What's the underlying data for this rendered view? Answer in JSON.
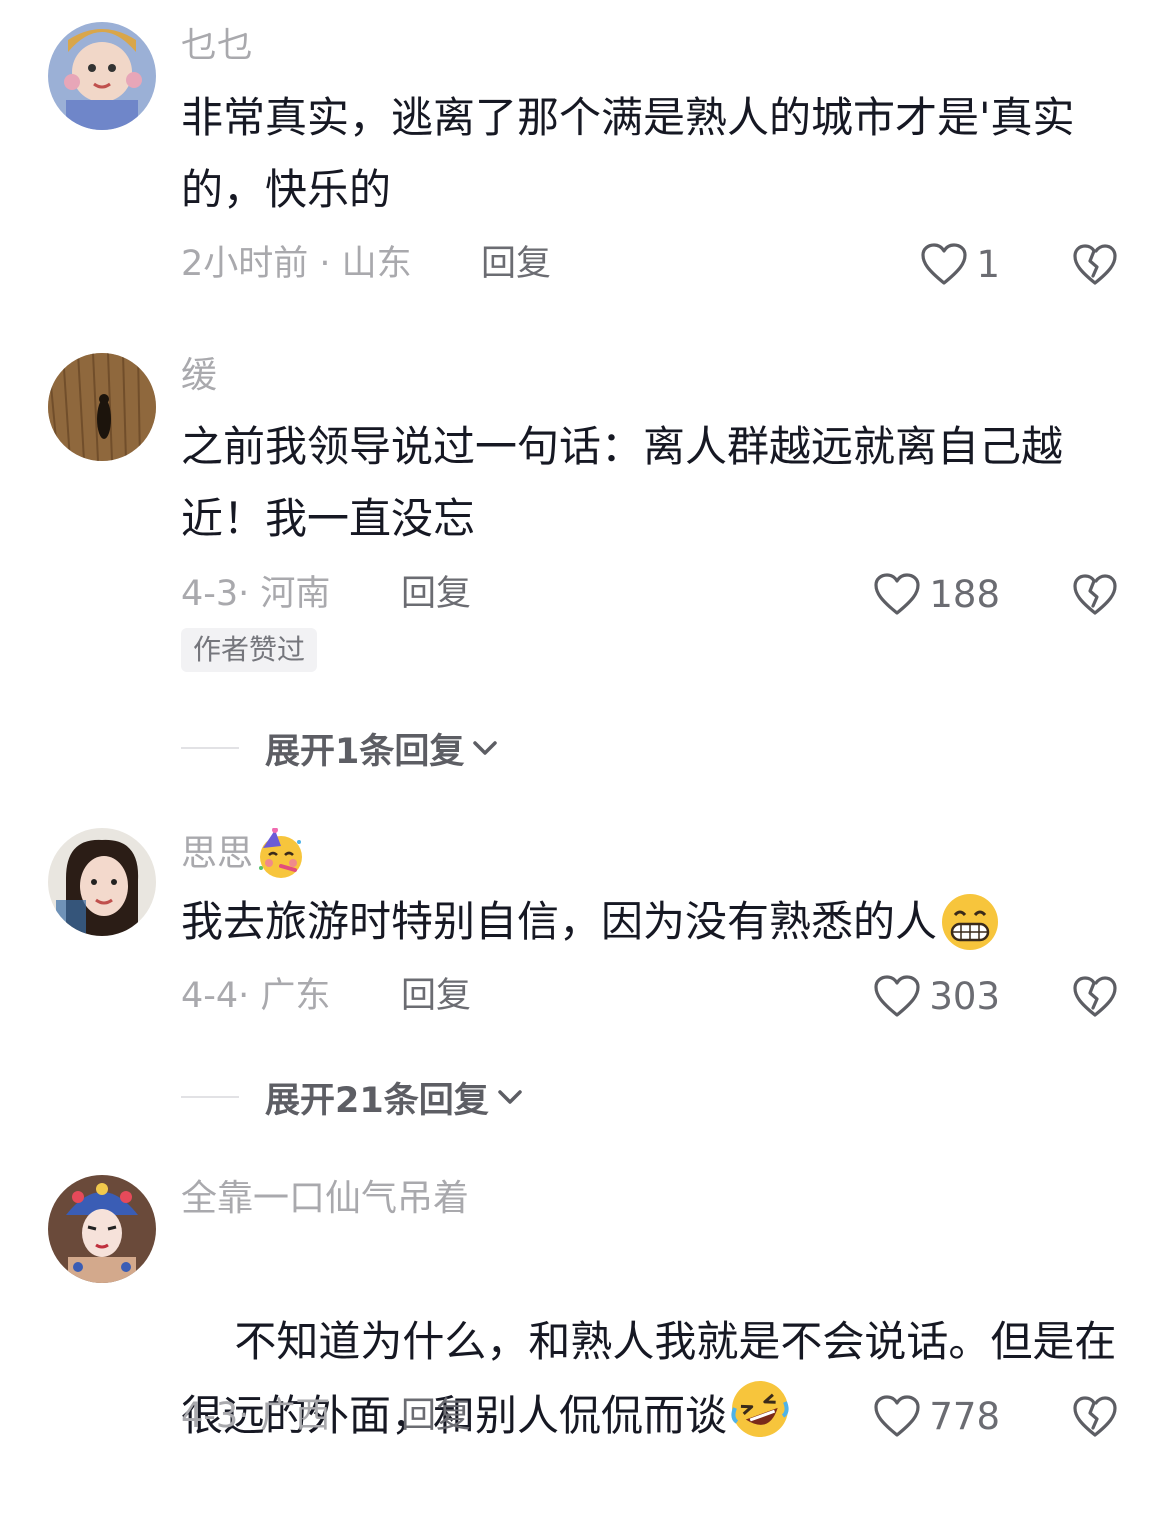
{
  "comments": [
    {
      "username": "乜乜",
      "text": "非常真实，逃离了那个满是熟人的城市才是'真实的，快乐的",
      "meta": "2小时前 · 山东",
      "reply_label": "回复",
      "likes": "1"
    },
    {
      "username": "缓",
      "text": "之前我领导说过一句话：离人群越远就离自己越近！我一直没忘",
      "meta": "4-3· 河南",
      "reply_label": "回复",
      "likes": "188",
      "badge": "作者赞过",
      "expand_label": "展开1条回复"
    },
    {
      "username": "思思",
      "text": "我去旅游时特别自信，因为没有熟悉的人",
      "meta": "4-4· 广东",
      "reply_label": "回复",
      "likes": "303",
      "expand_label": "展开21条回复"
    },
    {
      "username": "全靠一口仙气吊着",
      "text": "不知道为什么，和熟人我就是不会说话。但是在很远的外面，和别人侃侃而谈",
      "meta": "4-3· 广西",
      "reply_label": "回复",
      "likes": "778"
    }
  ],
  "colors": {
    "text_primary": "#161823",
    "text_secondary": "#a9a9ad",
    "badge_bg": "#f2f2f4"
  },
  "icons": [
    "heart-outline-icon",
    "broken-heart-icon",
    "chevron-down-icon",
    "party-face-emoji",
    "grinning-face-emoji",
    "rolling-laughing-emoji"
  ]
}
